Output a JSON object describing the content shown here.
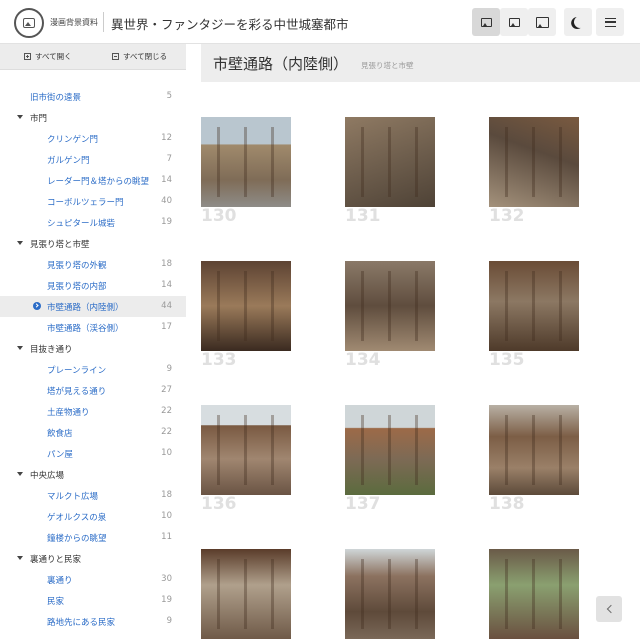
{
  "header": {
    "site_name": "漫画背景資料",
    "page_heading": "異世界・ファンタジーを彩る中世城塞都市",
    "buttons": [
      "image-view",
      "image-grid",
      "image-large",
      "dark-mode",
      "menu"
    ]
  },
  "sidebar": {
    "expand_all": "すべて開く",
    "collapse_all": "すべて閉じる",
    "items": [
      {
        "label": "旧市街の遠景",
        "count": "5",
        "type": "top"
      },
      {
        "label": "市門",
        "count": "",
        "type": "cat"
      },
      {
        "label": "クリンゲン門",
        "count": "12",
        "type": "sub"
      },
      {
        "label": "ガルゲン門",
        "count": "7",
        "type": "sub"
      },
      {
        "label": "レーダー門＆塔からの眺望",
        "count": "14",
        "type": "sub"
      },
      {
        "label": "コーボルツェラー門",
        "count": "40",
        "type": "sub"
      },
      {
        "label": "シュピタール城砦",
        "count": "19",
        "type": "sub"
      },
      {
        "label": "見張り塔と市壁",
        "count": "",
        "type": "cat"
      },
      {
        "label": "見張り塔の外観",
        "count": "18",
        "type": "sub"
      },
      {
        "label": "見張り塔の内部",
        "count": "14",
        "type": "sub"
      },
      {
        "label": "市壁通路（内陸側）",
        "count": "44",
        "type": "selected"
      },
      {
        "label": "市壁通路（渓谷側）",
        "count": "17",
        "type": "sub"
      },
      {
        "label": "目抜き通り",
        "count": "",
        "type": "cat"
      },
      {
        "label": "プレーンライン",
        "count": "9",
        "type": "sub"
      },
      {
        "label": "塔が見える通り",
        "count": "27",
        "type": "sub"
      },
      {
        "label": "土産物通り",
        "count": "22",
        "type": "sub"
      },
      {
        "label": "飲食店",
        "count": "22",
        "type": "sub"
      },
      {
        "label": "パン屋",
        "count": "10",
        "type": "sub"
      },
      {
        "label": "中央広場",
        "count": "",
        "type": "cat"
      },
      {
        "label": "マルクト広場",
        "count": "18",
        "type": "sub"
      },
      {
        "label": "ゲオルクスの泉",
        "count": "10",
        "type": "sub"
      },
      {
        "label": "鐘楼からの眺望",
        "count": "11",
        "type": "sub"
      },
      {
        "label": "裏通りと民家",
        "count": "",
        "type": "cat"
      },
      {
        "label": "裏通り",
        "count": "30",
        "type": "sub"
      },
      {
        "label": "民家",
        "count": "19",
        "type": "sub"
      },
      {
        "label": "路地先にある民家",
        "count": "9",
        "type": "sub"
      }
    ]
  },
  "main": {
    "title": "市壁通路（内陸側）",
    "breadcrumb": "見張り塔と市壁",
    "photos": [
      "130",
      "131",
      "132",
      "133",
      "134",
      "135",
      "136",
      "137",
      "138",
      "",
      "",
      ""
    ]
  }
}
